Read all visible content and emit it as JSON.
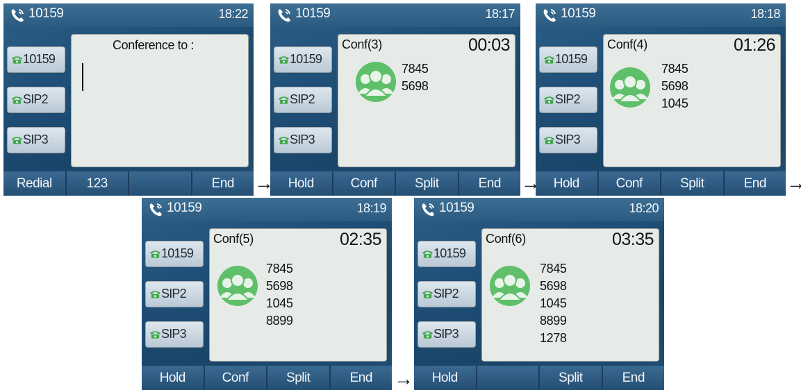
{
  "colors": {
    "screen_background": "#224e72",
    "content_panel": "#e6ebe7",
    "line_key": "#cdd7e0",
    "avatar_green": "#5fbf6a",
    "handset_green": "#3fa84a",
    "text_dark": "#111111",
    "text_light": "#f2f6fa"
  },
  "icons": {
    "status": "phone-call-icon",
    "line_key": "green-desk-phone-icon",
    "avatar": "conference-contacts-avatar-icon",
    "flow": "right-arrow-icon"
  },
  "screens": [
    {
      "status": {
        "account": "10159",
        "time": "18:22"
      },
      "line_keys": [
        "10159",
        "SIP2",
        "SIP3"
      ],
      "prompt": "Conference to :",
      "softkeys": [
        "Redial",
        "123",
        "",
        "End"
      ]
    },
    {
      "status": {
        "account": "10159",
        "time": "18:17"
      },
      "line_keys": [
        "10159",
        "SIP2",
        "SIP3"
      ],
      "conference": {
        "title": "Conf(3)",
        "timer": "00:03",
        "participants": [
          "7845",
          "5698"
        ]
      },
      "softkeys": [
        "Hold",
        "Conf",
        "Split",
        "End"
      ]
    },
    {
      "status": {
        "account": "10159",
        "time": "18:18"
      },
      "line_keys": [
        "10159",
        "SIP2",
        "SIP3"
      ],
      "conference": {
        "title": "Conf(4)",
        "timer": "01:26",
        "participants": [
          "7845",
          "5698",
          "1045"
        ]
      },
      "softkeys": [
        "Hold",
        "Conf",
        "Split",
        "End"
      ]
    },
    {
      "status": {
        "account": "10159",
        "time": "18:19"
      },
      "line_keys": [
        "10159",
        "SIP2",
        "SIP3"
      ],
      "conference": {
        "title": "Conf(5)",
        "timer": "02:35",
        "participants": [
          "7845",
          "5698",
          "1045",
          "8899"
        ]
      },
      "softkeys": [
        "Hold",
        "Conf",
        "Split",
        "End"
      ]
    },
    {
      "status": {
        "account": "10159",
        "time": "18:20"
      },
      "line_keys": [
        "10159",
        "SIP2",
        "SIP3"
      ],
      "conference": {
        "title": "Conf(6)",
        "timer": "03:35",
        "participants": [
          "7845",
          "5698",
          "1045",
          "8899",
          "1278"
        ]
      },
      "softkeys": [
        "Hold",
        "",
        "Split",
        "End"
      ]
    }
  ],
  "arrows": [
    "→",
    "→",
    "→",
    "→"
  ]
}
